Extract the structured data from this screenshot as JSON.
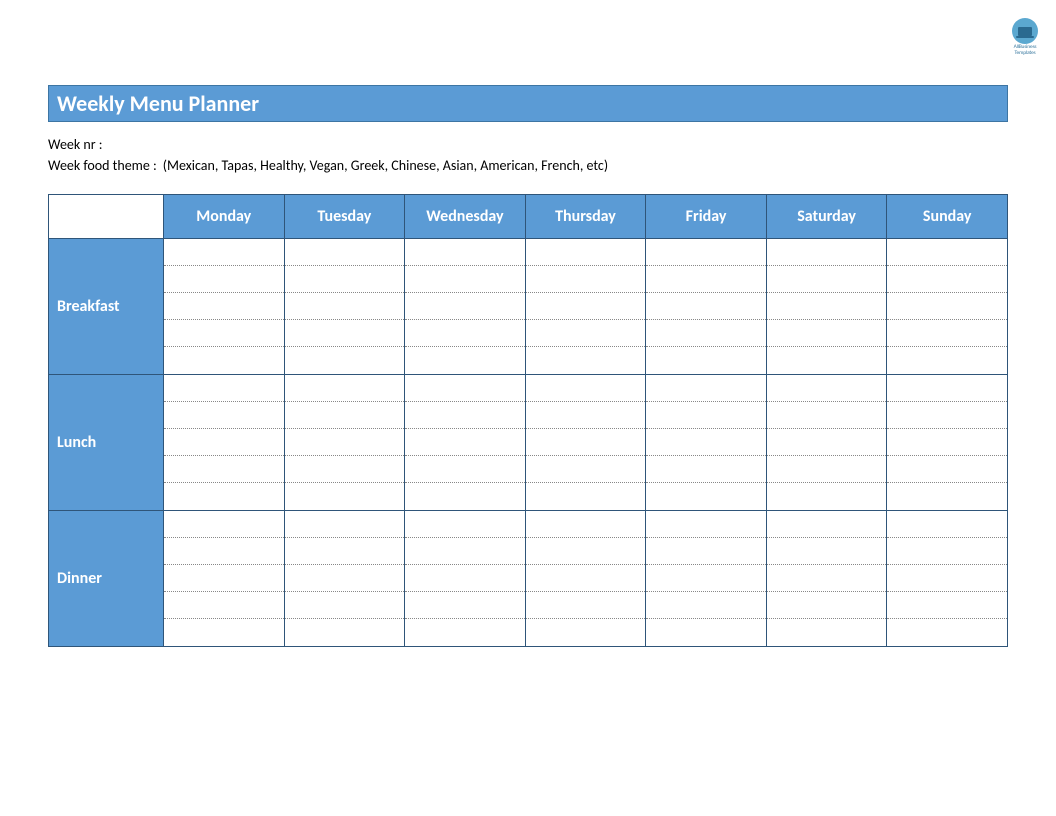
{
  "logo": {
    "line1": "AllBusiness",
    "line2": "Templates"
  },
  "title": "Weekly Menu Planner",
  "meta": {
    "week_nr_label": "Week nr :",
    "week_nr_value": "",
    "theme_label": "Week food theme :",
    "theme_hint": "(Mexican, Tapas, Healthy, Vegan, Greek, Chinese, Asian, American, French, etc)"
  },
  "days": [
    "Monday",
    "Tuesday",
    "Wednesday",
    "Thursday",
    "Friday",
    "Saturday",
    "Sunday"
  ],
  "meals": [
    "Breakfast",
    "Lunch",
    "Dinner"
  ],
  "lines_per_cell": 5
}
